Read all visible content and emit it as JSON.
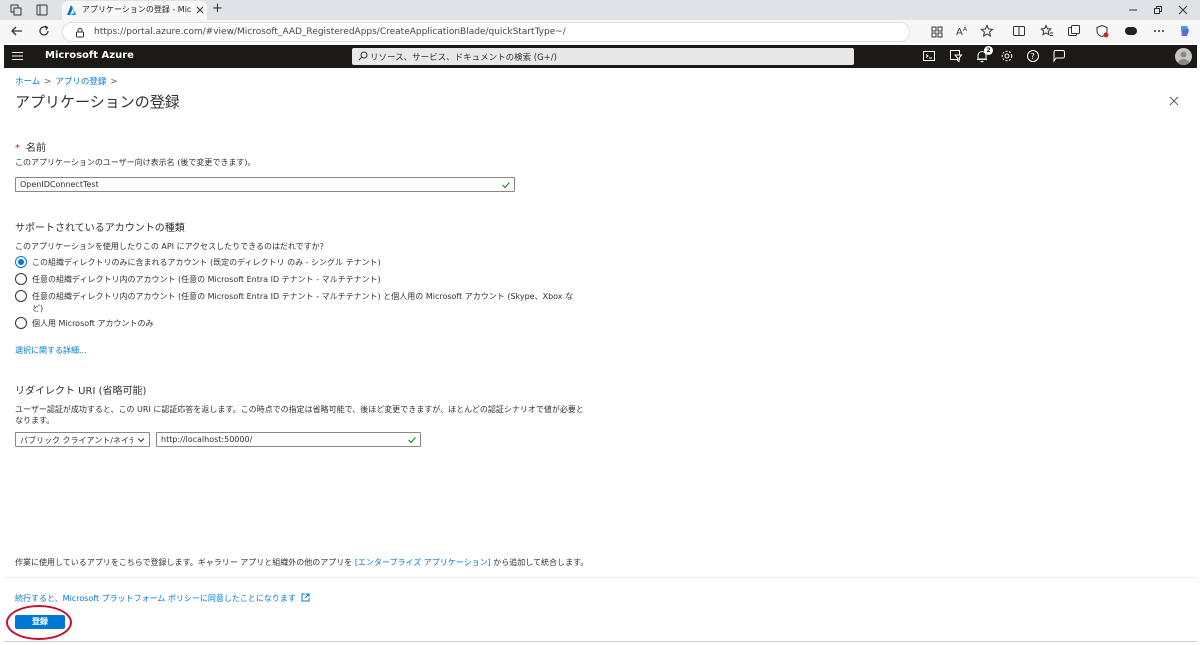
{
  "browser": {
    "tab_title": "アプリケーションの登録 - Microsoft Azure",
    "url": "https://portal.azure.com/#view/Microsoft_AAD_RegisteredApps/CreateApplicationBlade/quickStartType~/",
    "new_tab_label": "+"
  },
  "azure": {
    "brand": "Microsoft Azure",
    "search_placeholder": "リソース、サービス、ドキュメントの検索 (G+/)",
    "notification_count": "2"
  },
  "breadcrumb": {
    "home": "ホーム",
    "apps": "アプリの登録",
    "sep": ">"
  },
  "page": {
    "title": "アプリケーションの登録",
    "more": "…"
  },
  "name_section": {
    "required_mark": "*",
    "title": "名前",
    "hint": "このアプリケーションのユーザー向け表示名 (後で変更できます)。",
    "value": "OpenIDConnectTest"
  },
  "account_section": {
    "title": "サポートされているアカウントの種類",
    "question": "このアプリケーションを使用したりこの API にアクセスしたりできるのはだれですか?",
    "options": [
      {
        "label": "この組織ディレクトリのみに含まれるアカウント (既定のディレクトリ のみ - シングル テナント)",
        "checked": true
      },
      {
        "label": "任意の組織ディレクトリ内のアカウント (任意の Microsoft Entra ID テナント - マルチテナント)",
        "checked": false
      },
      {
        "label": "任意の組織ディレクトリ内のアカウント (任意の Microsoft Entra ID テナント - マルチテナント) と個人用の Microsoft アカウント (Skype、Xbox な",
        "label2": "ど)",
        "checked": false
      },
      {
        "label": "個人用 Microsoft アカウントのみ",
        "checked": false
      }
    ],
    "help_link": "選択に関する詳細..."
  },
  "redirect_section": {
    "title": "リダイレクト URI (省略可能)",
    "hint_line1": "ユーザー認証が成功すると、この URI に認証応答を返します。この時点での指定は省略可能で、後ほど変更できますが、ほとんどの認証シナリオで値が必要と",
    "hint_line2": "なります。",
    "platform": "パブリック クライアント/ネイティブ...",
    "uri": "http://localhost:50000/"
  },
  "footer": {
    "note_before": "作業に使用しているアプリをこちらで登録します。ギャラリー アプリと組織外の他のアプリを ",
    "note_link": "[エンタープライズ アプリケーション]",
    "note_after": " から追加して統合します。",
    "policy_link": "続行すると、Microsoft プラットフォーム ポリシーに同意したことになります",
    "register_label": "登録"
  },
  "colors": {
    "accent": "#0078d4",
    "header_bg": "#1b1a19",
    "highlight": "#c8102e"
  }
}
